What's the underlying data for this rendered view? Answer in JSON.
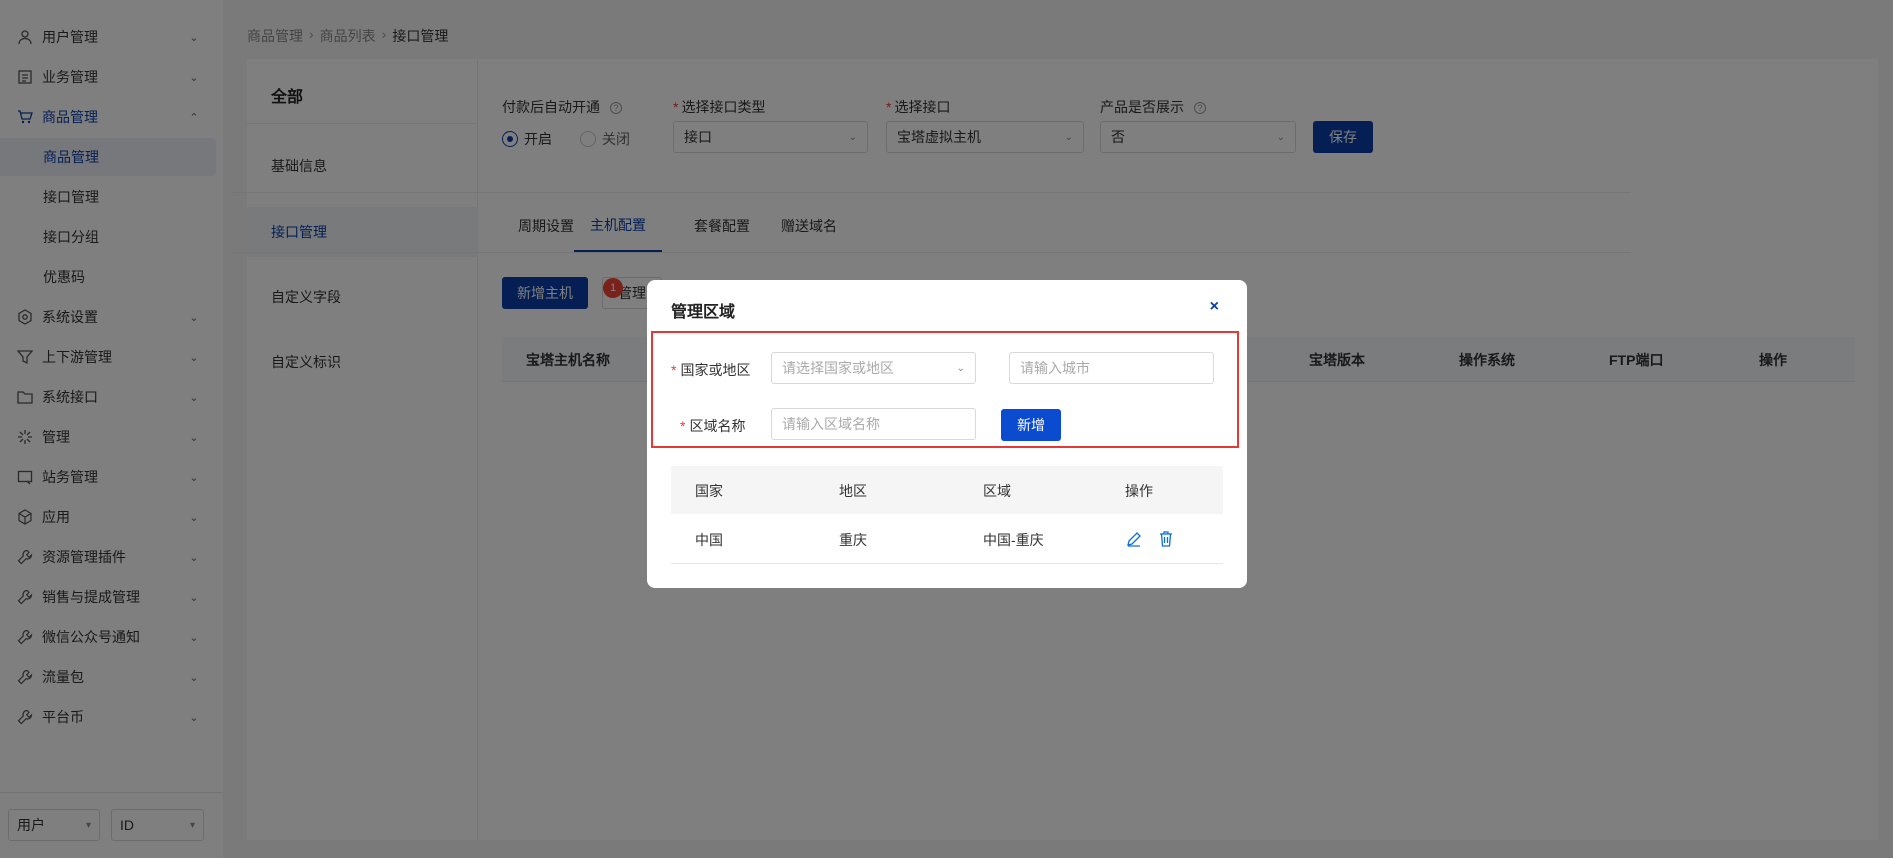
{
  "sidebar": {
    "menu": [
      {
        "label": "用户管理",
        "icon": "user-icon"
      },
      {
        "label": "业务管理",
        "icon": "document-icon"
      },
      {
        "label": "商品管理",
        "icon": "cart-icon"
      },
      {
        "label": "系统设置",
        "icon": "settings-icon"
      },
      {
        "label": "上下游管理",
        "icon": "filter-icon"
      },
      {
        "label": "系统接口",
        "icon": "folder-icon"
      },
      {
        "label": "管理",
        "icon": "sparkle-icon"
      },
      {
        "label": "站务管理",
        "icon": "site-icon"
      },
      {
        "label": "应用",
        "icon": "cube-icon"
      },
      {
        "label": "资源管理插件",
        "icon": "wrench-icon"
      },
      {
        "label": "销售与提成管理",
        "icon": "wrench-icon"
      },
      {
        "label": "微信公众号通知",
        "icon": "wrench-icon"
      },
      {
        "label": "流量包",
        "icon": "wrench-icon"
      },
      {
        "label": "平台币",
        "icon": "wrench-icon"
      }
    ],
    "submenu": [
      "商品管理",
      "接口管理",
      "接口分组",
      "优惠码"
    ],
    "bottom": {
      "select1": "用户",
      "select2": "ID"
    }
  },
  "breadcrumb": {
    "items": [
      "商品管理",
      "商品列表",
      "接口管理"
    ]
  },
  "left_nav": {
    "title": "全部",
    "items": [
      "基础信息",
      "接口管理",
      "自定义字段",
      "自定义标识"
    ]
  },
  "form": {
    "auto_open_label": "付款后自动开通",
    "radio_on": "开启",
    "radio_off": "关闭",
    "interface_type_label": "选择接口类型",
    "interface_type_value": "接口",
    "interface_label": "选择接口",
    "interface_value": "宝塔虚拟主机",
    "show_label": "产品是否展示",
    "show_value": "否",
    "save": "保存"
  },
  "tabs": [
    "周期设置",
    "主机配置",
    "套餐配置",
    "赠送域名"
  ],
  "actions": {
    "add_host": "新增主机",
    "manage_partial": "管理",
    "badge": "1"
  },
  "table_headers": [
    "宝塔主机名称",
    "宝塔版本",
    "操作系统",
    "FTP端口",
    "操作"
  ],
  "modal": {
    "title": "管理区域",
    "close": "×",
    "country_label": "国家或地区",
    "country_placeholder": "请选择国家或地区",
    "city_placeholder": "请输入城市",
    "area_label": "区域名称",
    "area_placeholder": "请输入区域名称",
    "add": "新增",
    "headers": [
      "国家",
      "地区",
      "区域",
      "操作"
    ],
    "rows": [
      {
        "country": "中国",
        "region": "重庆",
        "area": "中国-重庆"
      }
    ]
  },
  "colors": {
    "primary": "#0b3ea8",
    "danger": "#e53935",
    "link": "#0b6fd8"
  }
}
